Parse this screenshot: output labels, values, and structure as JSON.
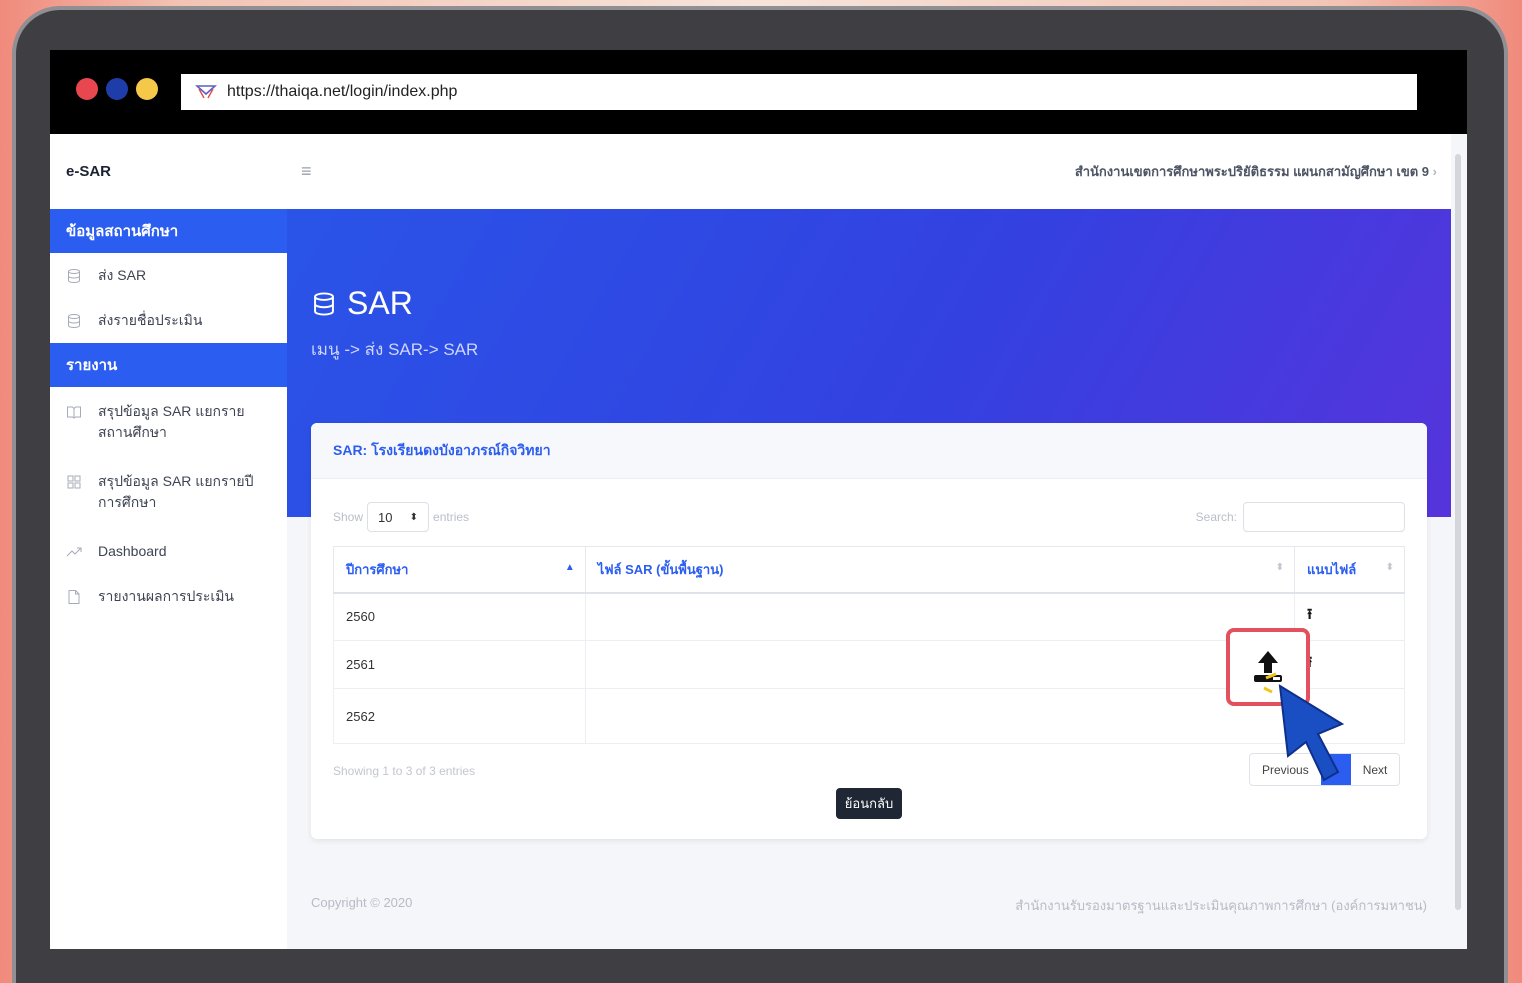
{
  "browser": {
    "url": "https://thaiqa.net/login/index.php"
  },
  "sidebar": {
    "brand": "e-SAR",
    "section1": "ข้อมูลสถานศึกษา",
    "items1": [
      {
        "label": "ส่ง SAR",
        "icon": "database-icon"
      },
      {
        "label": "ส่งรายชื่อประเมิน",
        "icon": "database-icon"
      }
    ],
    "section2": "รายงาน",
    "items2": [
      {
        "label": "สรุปข้อมูล SAR แยกรายสถานศึกษา",
        "icon": "book-icon"
      },
      {
        "label": "สรุปข้อมูล SAR แยกรายปีการศึกษา",
        "icon": "grid-icon"
      },
      {
        "label": "Dashboard",
        "icon": "trending-icon"
      },
      {
        "label": "รายงานผลการประเมิน",
        "icon": "file-icon"
      }
    ]
  },
  "header": {
    "menu_icon": "hamburger-icon",
    "school": "สำนักงานเขตการศึกษาพระปริยัติธรรม แผนกสามัญศึกษา เขต 9",
    "chevron": "›"
  },
  "hero": {
    "title": "SAR",
    "breadcrumb": "เมนู -> ส่ง SAR-> SAR"
  },
  "card": {
    "title": "SAR: โรงเรียนดงบังอาภรณ์กิจวิทยา",
    "show_label": "Show",
    "entries_label": "entries",
    "page_length": "10",
    "search_label": "Search:",
    "columns": [
      "ปีการศึกษา",
      "ไฟล์ SAR (ขั้นพื้นฐาน)",
      "แนบไฟล์"
    ],
    "rows": [
      {
        "year": "2560",
        "file": "",
        "attach": "⭱"
      },
      {
        "year": "2561",
        "file": "",
        "attach": "⭱"
      },
      {
        "year": "2562",
        "file": "",
        "attach": ""
      }
    ],
    "info": "Showing 1 to 3 of 3 entries",
    "prev": "Previous",
    "next": "Next",
    "back": "ย้อนกลับ"
  },
  "footer": {
    "copyright": "Copyright © 2020",
    "org": "สำนักงานรับรองมาตรฐานและประเมินคุณภาพการศึกษา (องค์การมหาชน)"
  },
  "colors": {
    "accent": "#2b5df0",
    "highlight": "#e3505e",
    "cursor": "#1a4fc4"
  }
}
